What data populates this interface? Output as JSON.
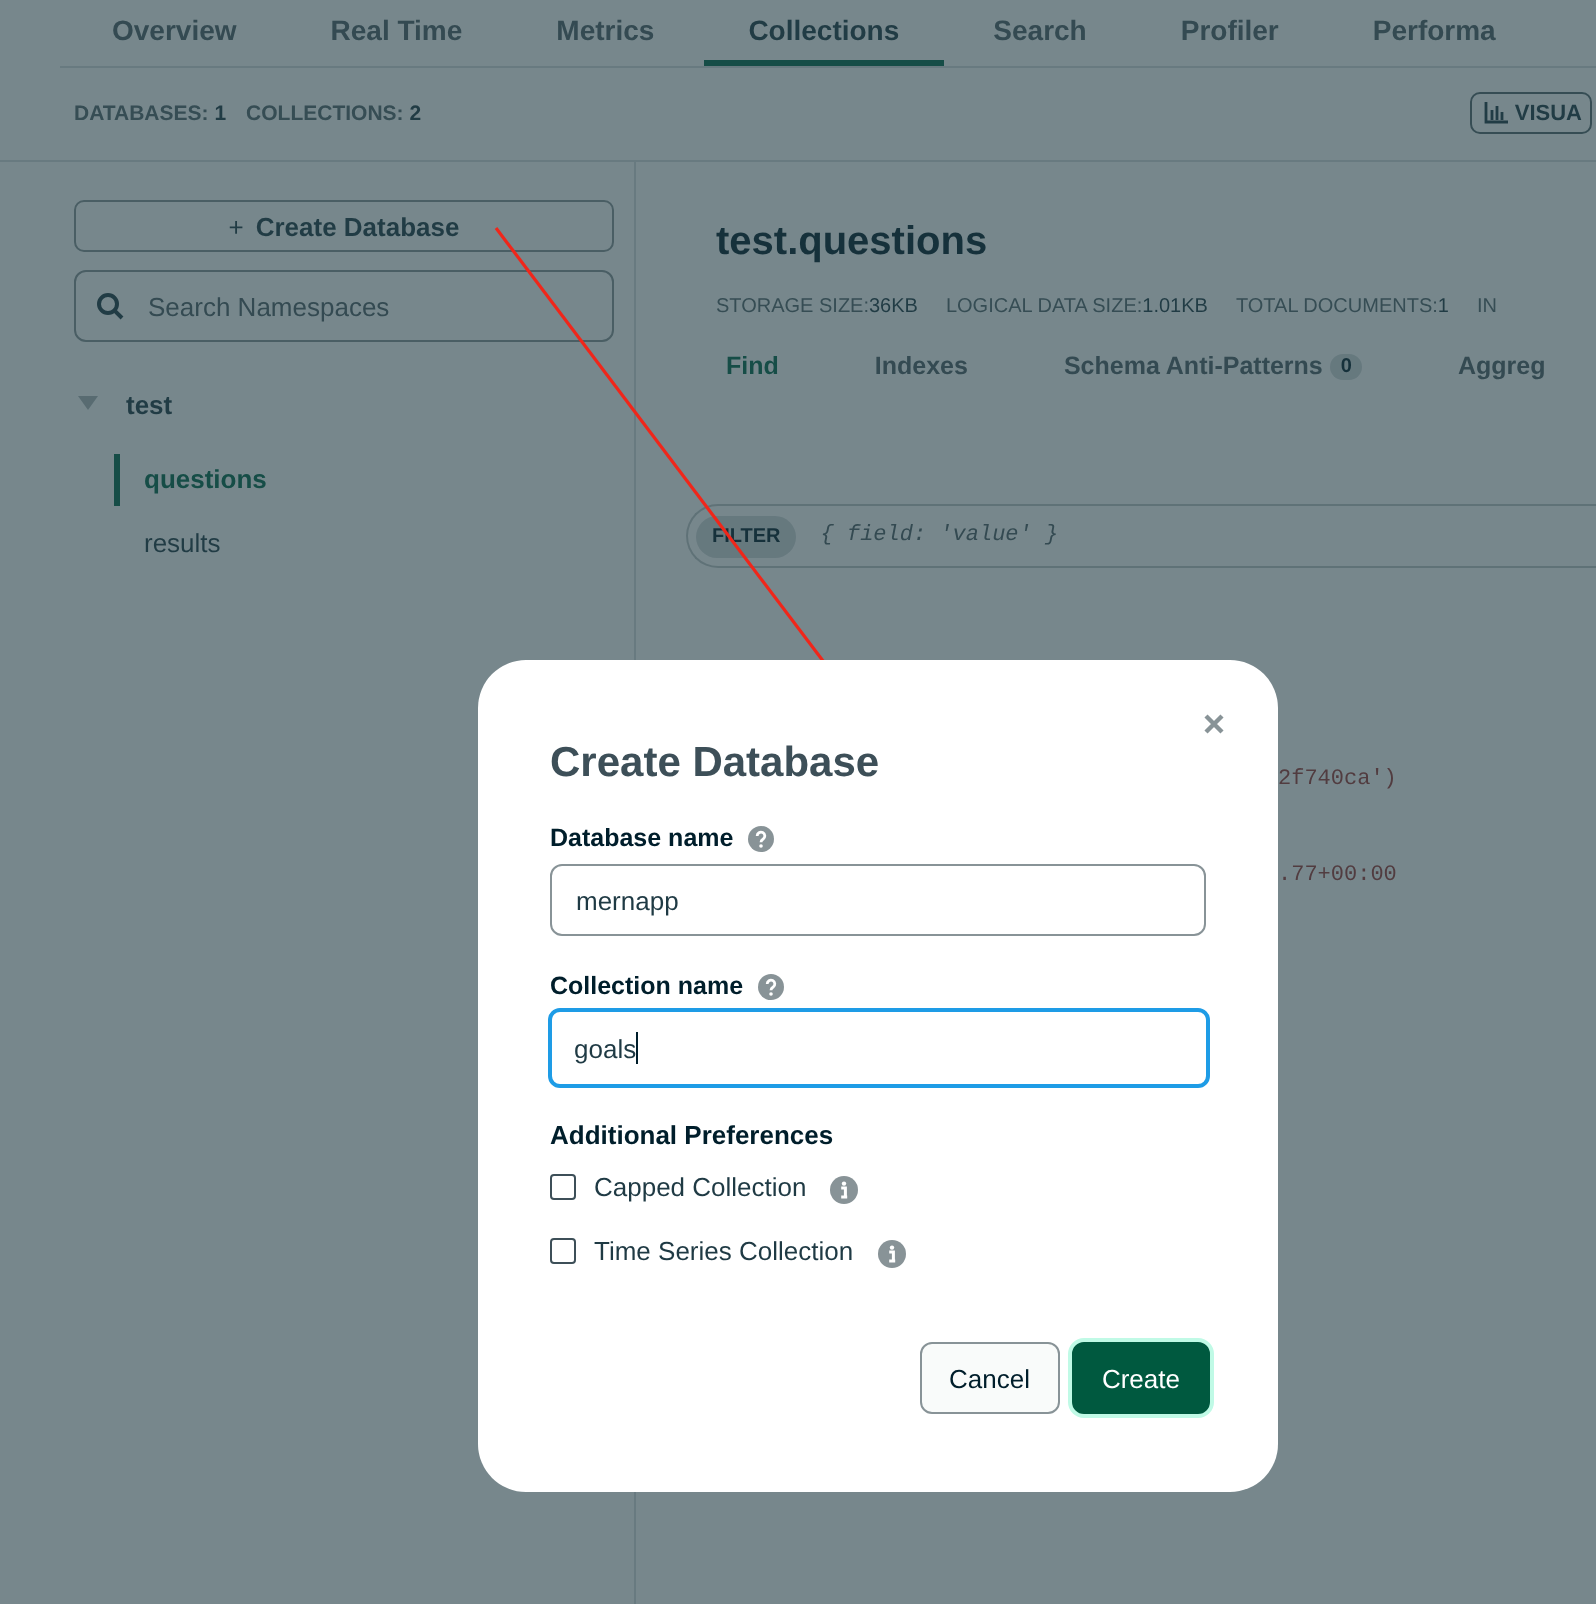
{
  "tabs": [
    {
      "label": "Overview",
      "selected": false
    },
    {
      "label": "Real Time",
      "selected": false
    },
    {
      "label": "Metrics",
      "selected": false
    },
    {
      "label": "Collections",
      "selected": true
    },
    {
      "label": "Search",
      "selected": false
    },
    {
      "label": "Profiler",
      "selected": false
    },
    {
      "label": "Performa",
      "selected": false
    }
  ],
  "summary": [
    {
      "label": "DATABASES:",
      "value": "1"
    },
    {
      "label": "COLLECTIONS:",
      "value": "2"
    }
  ],
  "visualize_button": "VISUA",
  "sidebar": {
    "create_button": {
      "icon": "+",
      "label": "Create Database"
    },
    "search": {
      "placeholder": "Search Namespaces"
    },
    "tree": [
      {
        "label": "test",
        "expanded": true,
        "selected": false,
        "children": [
          {
            "label": "questions",
            "selected": true
          },
          {
            "label": "results",
            "selected": false
          }
        ]
      }
    ]
  },
  "collection": {
    "title": "test.questions",
    "stats": [
      {
        "label": "STORAGE SIZE:",
        "value": "36KB"
      },
      {
        "label": "LOGICAL DATA SIZE:",
        "value": "1.01KB"
      },
      {
        "label": "TOTAL DOCUMENTS:",
        "value": "1"
      },
      {
        "label": "IN"
      }
    ],
    "tabs": [
      {
        "label": "Find",
        "selected": true
      },
      {
        "label": "Indexes",
        "selected": false
      },
      {
        "label": "Schema Anti-Patterns",
        "badge": "0",
        "selected": false
      },
      {
        "label": "Aggreg",
        "selected": false
      }
    ],
    "filter": {
      "label": "FILTER",
      "placeholder": "{ field: 'value' }"
    },
    "document_lines": [
      "2f740ca')",
      ".77+00:00"
    ]
  },
  "dialog": {
    "title": "Create Database",
    "fields": [
      {
        "label": "Database name",
        "value": "mernapp",
        "focused": false
      },
      {
        "label": "Collection name",
        "value": "goals",
        "focused": true
      }
    ],
    "preferences_title": "Additional Preferences",
    "options": [
      {
        "label": "Capped Collection",
        "checked": false
      },
      {
        "label": "Time Series Collection",
        "checked": false
      }
    ],
    "buttons": [
      {
        "label": "Cancel",
        "kind": "secondary"
      },
      {
        "label": "Create",
        "kind": "primary"
      }
    ]
  }
}
